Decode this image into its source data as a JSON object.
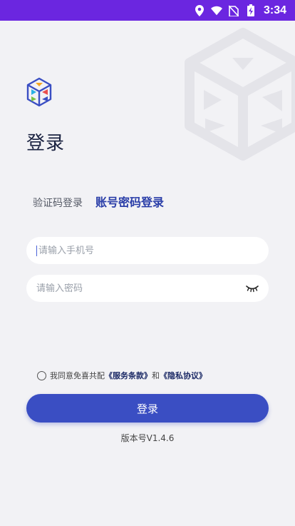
{
  "status_bar": {
    "time": "3:34",
    "icons": [
      "location-icon",
      "wifi-icon",
      "no-sim-icon",
      "battery-charging-icon"
    ],
    "background": "#6b26e0"
  },
  "login": {
    "title": "登录",
    "tabs": {
      "sms": "验证码登录",
      "password": "账号密码登录",
      "active": "password"
    },
    "phone": {
      "placeholder": "请输入手机号",
      "value": ""
    },
    "password": {
      "placeholder": "请输入密码",
      "value": ""
    },
    "agreement": {
      "prefix": "我同意免喜共配",
      "service_link": "《服务条款》",
      "conjunction": "和",
      "privacy_link": "《隐私协议》",
      "checked": false
    },
    "button_label": "登录",
    "version": "版本号V1.4.6"
  },
  "colors": {
    "accent": "#3a4ec3",
    "active_tab": "#2a3ea8",
    "background": "#f2f2f5"
  }
}
